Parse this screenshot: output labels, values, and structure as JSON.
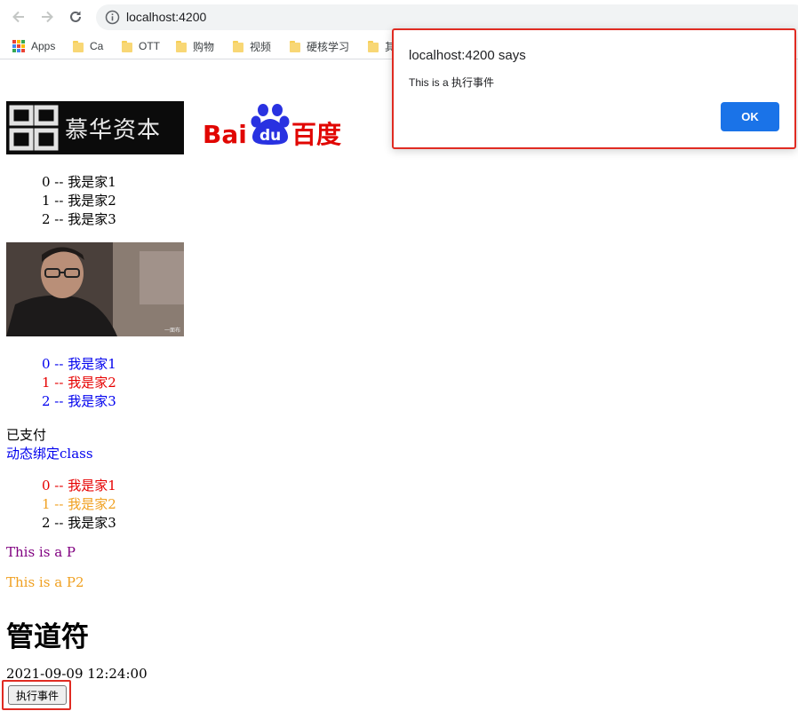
{
  "browser": {
    "url": "localhost:4200",
    "bookmarks": [
      "Apps",
      "Ca",
      "OTT",
      "购物",
      "视频",
      "硬核学习",
      "其"
    ]
  },
  "page": {
    "logos": {
      "left_text": "慕华资本",
      "baidu_bai": "Bai",
      "baidu_du": "du",
      "baidu_cn": "百度"
    },
    "list1": [
      "0 -- 我是家1",
      "1 -- 我是家2",
      "2 -- 我是家3"
    ],
    "photo_caption": "一面布",
    "list2": [
      {
        "text": "0 -- 我是家1",
        "color": "#0000ee"
      },
      {
        "text": "1 -- 我是家2",
        "color": "#e60000"
      },
      {
        "text": "2 -- 我是家3",
        "color": "#0000ee"
      }
    ],
    "paid_text": "已支付",
    "dynamic_class_text": "动态绑定class",
    "list3": [
      {
        "text": "0 -- 我是家1",
        "color": "#e60000"
      },
      {
        "text": "1 -- 我是家2",
        "color": "#f0a020"
      },
      {
        "text": "2 -- 我是家3",
        "color": "#000000"
      }
    ],
    "p1": "This is a P",
    "p2": "This is a P2",
    "heading": "管道符",
    "datetime": "2021-09-09 12:24:00",
    "exec_button": "执行事件"
  },
  "dialog": {
    "title": "localhost:4200 says",
    "message": "This is a 执行事件",
    "ok_label": "OK"
  },
  "colors": {
    "link_blue": "#0000ee",
    "red": "#e60000",
    "orange": "#f0a020",
    "purple": "#800080",
    "chrome_blue": "#1a73e8",
    "highlight_red": "#e02b22"
  }
}
